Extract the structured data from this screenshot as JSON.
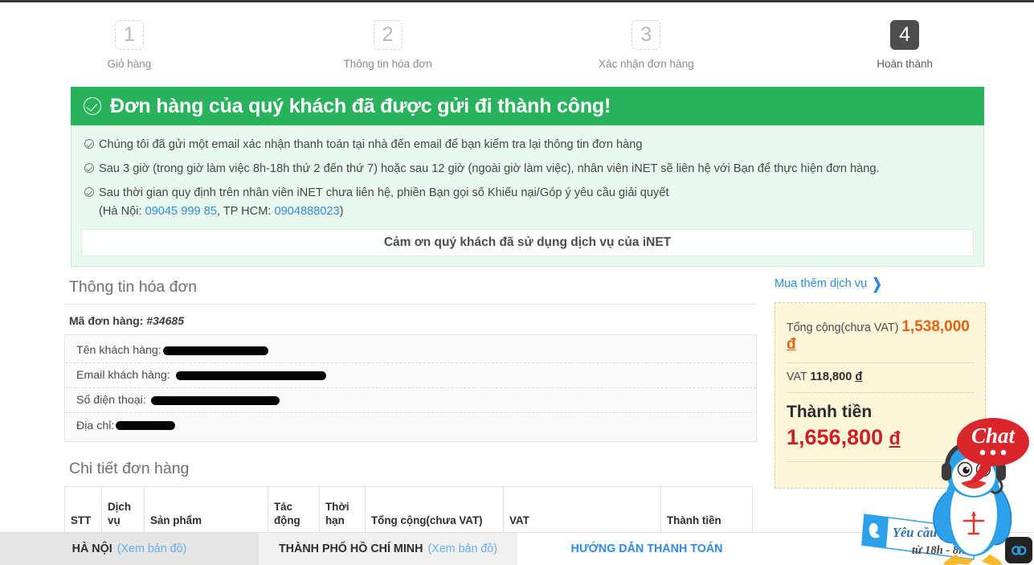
{
  "steps": [
    {
      "number": "1",
      "label": "Giỏ hàng",
      "state": "pending"
    },
    {
      "number": "2",
      "label": "Thông tin hóa đơn",
      "state": "pending"
    },
    {
      "number": "3",
      "label": "Xác nhận đơn hàng",
      "state": "pending"
    },
    {
      "number": "4",
      "label": "Hoàn thành",
      "state": "active"
    }
  ],
  "alert": {
    "title": "Đơn hàng của quý khách đã được gửi đi thành công!",
    "icon": "check-circle-icon",
    "lines": [
      "Chúng tôi đã gửi một email xác nhận thanh toán tại nhà đến email để bạn kiểm tra lại thông tin đơn hàng",
      "Sau 3 giờ (trong giờ làm việc 8h-18h thứ 2 đến thứ 7) hoặc sau 12 giờ (ngoài giờ làm việc), nhân viên iNET sẽ liên hệ với Bạn để thực hiện đơn hàng."
    ],
    "line3_part1": "Sau thời gian quy định trên nhân viên iNET chưa liên hệ, phiền Bạn gọi số Khiếu nại/Góp ý yêu cầu giải quyết",
    "line3_prefix": "(Hà Nội: ",
    "phone_hanoi": "09045 999 85",
    "line3_mid": ", TP HCM: ",
    "phone_hcm": "0904888023",
    "line3_suffix": ")",
    "thanks": "Cảm ơn quý khách đã sử dụng dịch vụ của iNET"
  },
  "invoice": {
    "section_title": "Thông tin hóa đơn",
    "order_code_label": "Mã đơn hàng: ",
    "order_code_value": "#34685",
    "fields": [
      {
        "label": "Tên khách hàng:",
        "value": "",
        "redacted": true,
        "redact_width": 131
      },
      {
        "label": "Email khách hàng:",
        "value": "",
        "redacted": true,
        "redact_width": 187
      },
      {
        "label": "Số điện thoại:",
        "value": "",
        "redacted": true,
        "redact_width": 160
      },
      {
        "label": "Địa chỉ:",
        "value": "",
        "redacted": true,
        "redact_width": 74
      }
    ]
  },
  "detail": {
    "section_title": "Chi tiết đơn hàng",
    "columns": [
      "STT",
      "Dịch vụ",
      "Sản phẩm",
      "Tác động",
      "Thời hạn",
      "Tổng cộng(chưa VAT)",
      "VAT",
      "Thành tiền"
    ],
    "rows": []
  },
  "summary": {
    "buy_more_label": "Mua thêm dịch vụ",
    "buy_more_icon": "chevron-right-icon",
    "subtotal_label": "Tổng cộng(chưa VAT)",
    "subtotal_value": "1,538,000",
    "currency": "đ",
    "vat_label": "VAT",
    "vat_value": "118,800",
    "total_label": "Thành tiền",
    "total_value": "1,656,800"
  },
  "bottom_tabs": [
    {
      "name": "HÀ NỘI",
      "map_link": "(Xem bản đồ)",
      "active": true
    },
    {
      "name": "THÀNH PHỐ HỒ CHÍ MINH",
      "map_link": "(Xem bản đồ)",
      "active": false
    },
    {
      "name": "HƯỚNG DẪN THANH TOÁN",
      "map_link": "",
      "active": false
    }
  ],
  "chat_widget": {
    "bubble_text": "Chat",
    "bubble_dots": "•••",
    "callback_line1": "Yêu cầu gọi lại",
    "callback_line2": "từ 18h - 8h",
    "mascot": "penguin-headset-icon",
    "phone_icon": "phone-icon",
    "link_icon": "link-chain-icon"
  },
  "colors": {
    "success_green": "#28b25b",
    "alert_bg": "#eaf9ef",
    "link_blue": "#2e8ce0",
    "price_orange": "#e2620f",
    "total_red": "#cf1f27",
    "price_box_bg": "#fdf6d8",
    "step_active_bg": "#4d4d4d",
    "chat_red": "#d8262c",
    "mascot_blue": "#2ca0e8"
  }
}
